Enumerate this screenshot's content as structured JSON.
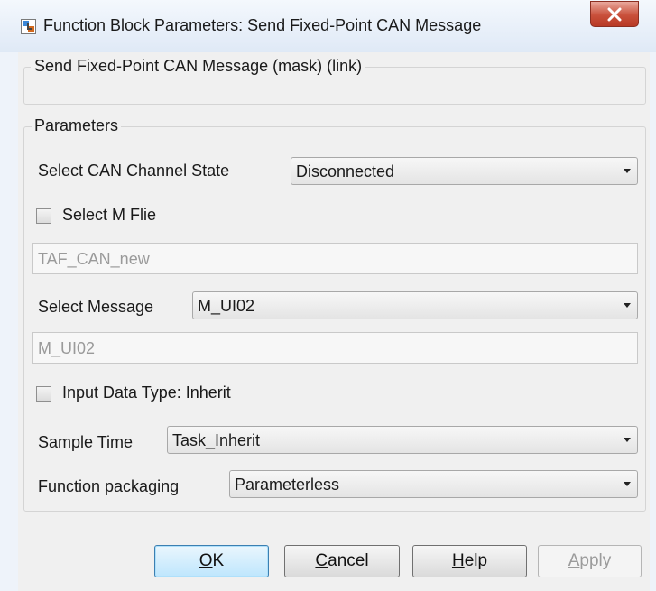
{
  "window": {
    "title": "Function Block Parameters: Send Fixed-Point CAN Message",
    "icon": "simulink-block-icon",
    "close_icon": "close-icon"
  },
  "description": {
    "title": "Send Fixed-Point CAN Message (mask) (link)"
  },
  "parameters": {
    "group_title": "Parameters",
    "can_channel_state": {
      "label": "Select CAN Channel State",
      "value": "Disconnected"
    },
    "select_m_file": {
      "label": "Select M Flie",
      "checked": false
    },
    "m_file_field": {
      "value": "TAF_CAN_new"
    },
    "select_message": {
      "label": "Select Message",
      "value": "M_UI02"
    },
    "message_field": {
      "value": "M_UI02"
    },
    "input_data_type": {
      "label": "Input Data Type: Inherit",
      "checked": false
    },
    "sample_time": {
      "label": "Sample Time",
      "value": "Task_Inherit"
    },
    "function_packaging": {
      "label": "Function packaging",
      "value": "Parameterless"
    }
  },
  "buttons": {
    "ok": {
      "mnemonic": "O",
      "rest": "K"
    },
    "cancel": {
      "mnemonic": "C",
      "rest": "ancel"
    },
    "help": {
      "mnemonic": "H",
      "rest": "elp"
    },
    "apply": {
      "mnemonic": "A",
      "rest": "pply"
    }
  }
}
